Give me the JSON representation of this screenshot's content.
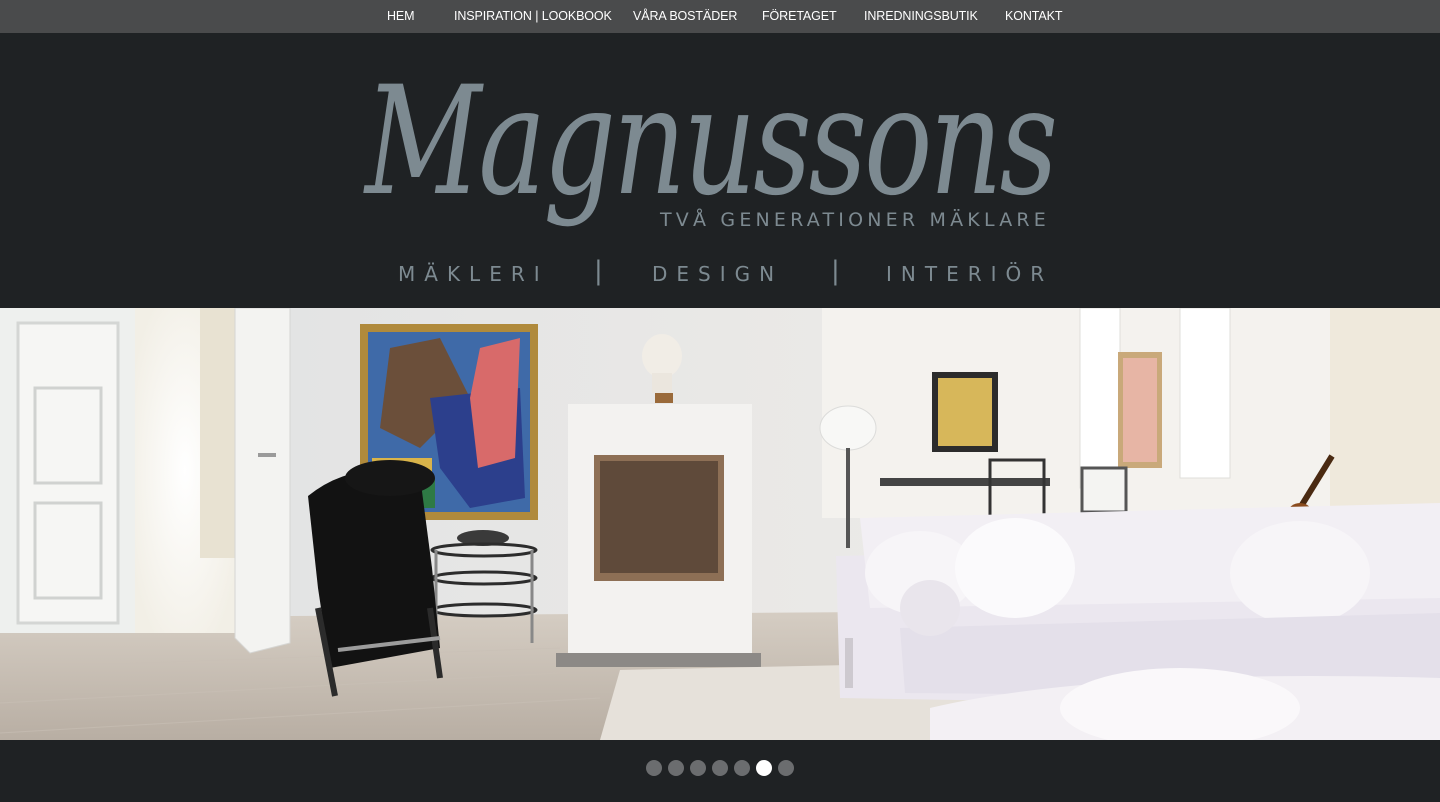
{
  "nav": {
    "items": [
      {
        "label": "HEM"
      },
      {
        "label": "INSPIRATION | LOOKBOOK"
      },
      {
        "label": "VÅRA BOSTÄDER"
      },
      {
        "label": "FÖRETAGET"
      },
      {
        "label": "INREDNINGSBUTIK"
      },
      {
        "label": "KONTAKT"
      }
    ]
  },
  "logo": {
    "name": "Magnussons",
    "tagline": "TVÅ GENERATIONER MÄKLARE",
    "services": [
      "MÄKLERI",
      "DESIGN",
      "INTERIÖR"
    ],
    "separator": "|",
    "color": "#7d8a91"
  },
  "hero": {
    "image": "living-room-photo"
  },
  "slider": {
    "slide_count": 7,
    "active_index": 5
  },
  "colors": {
    "nav_bg": "#4a4b4c",
    "page_bg": "#1f2224",
    "dot_inactive": "#6b6d6f",
    "dot_active": "#ffffff"
  }
}
